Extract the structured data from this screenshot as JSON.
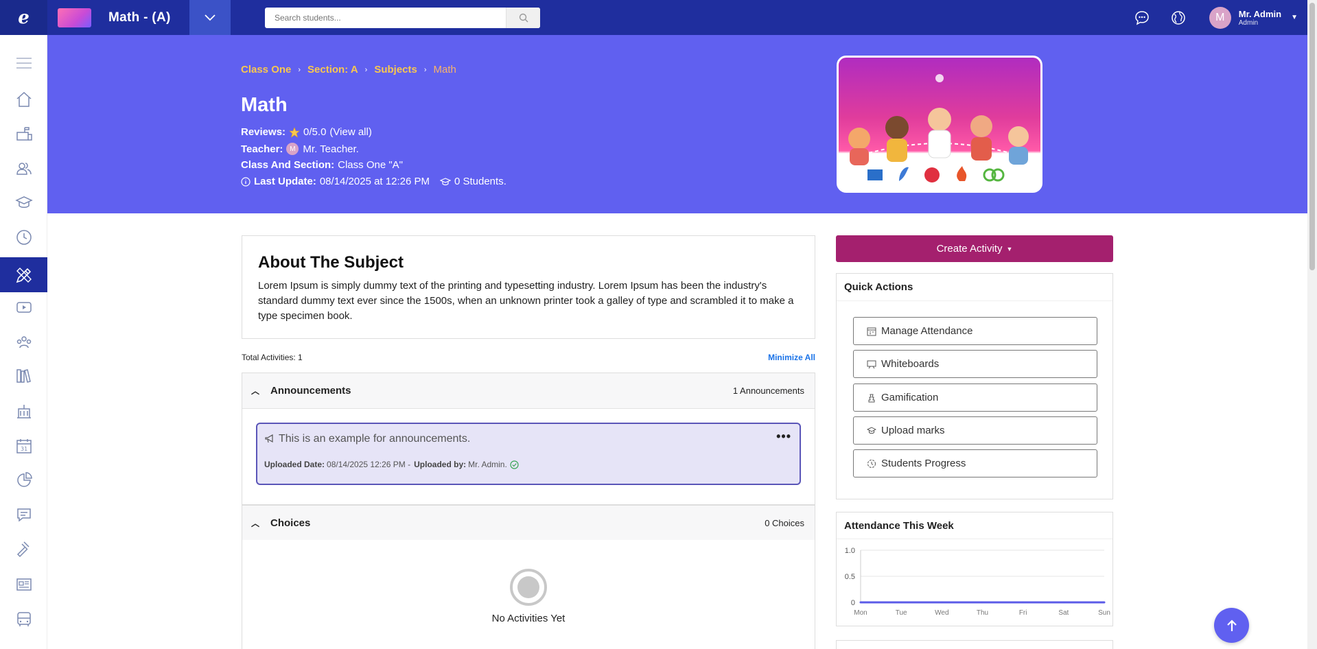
{
  "topbar": {
    "logo": "e",
    "app_title": "Math - (A)",
    "search_placeholder": "Search students...",
    "user": {
      "initial": "M",
      "name": "Mr. Admin",
      "role": "Admin"
    }
  },
  "sidebar": {
    "items": [
      {
        "icon": "menu-icon"
      },
      {
        "icon": "home-icon"
      },
      {
        "icon": "mailbox-icon"
      },
      {
        "icon": "users-icon"
      },
      {
        "icon": "graduation-cap-icon"
      },
      {
        "icon": "clock-icon"
      },
      {
        "icon": "subjects-pencil-ruler-icon",
        "active": true
      },
      {
        "icon": "video-icon"
      },
      {
        "icon": "group-icon"
      },
      {
        "icon": "library-icon"
      },
      {
        "icon": "building-icon"
      },
      {
        "icon": "calendar-icon"
      },
      {
        "icon": "pie-chart-icon"
      },
      {
        "icon": "chat-icon"
      },
      {
        "icon": "gavel-icon"
      },
      {
        "icon": "newspaper-icon"
      },
      {
        "icon": "bus-icon"
      }
    ]
  },
  "hero": {
    "breadcrumb": [
      "Class One",
      "Section: A",
      "Subjects",
      "Math"
    ],
    "title": "Math",
    "reviews_label": "Reviews:",
    "reviews_value": "0/5.0",
    "reviews_link": "(View all)",
    "teacher_label": "Teacher:",
    "teacher_initial": "M",
    "teacher_name": "Mr. Teacher.",
    "class_label": "Class And Section:",
    "class_value": "Class One \"A\"",
    "update_label": "Last Update:",
    "update_value": "08/14/2025 at 12:26 PM",
    "students": "0 Students."
  },
  "about": {
    "title": "About The Subject",
    "text": "Lorem Ipsum is simply dummy text of the printing and typesetting industry. Lorem Ipsum has been the industry's standard dummy text ever since the 1500s, when an unknown printer took a galley of type and scrambled it to make a type specimen book."
  },
  "activities": {
    "total": "Total Activities: 1",
    "minimize": "Minimize All",
    "announcements": {
      "title": "Announcements",
      "count": "1 Announcements",
      "item": {
        "message": "This is an example for announcements.",
        "date_label": "Uploaded Date:",
        "date_value": "08/14/2025 12:26 PM -",
        "by_label": "Uploaded by:",
        "by_value": "Mr. Admin."
      }
    },
    "choices": {
      "title": "Choices",
      "count": "0 Choices"
    },
    "empty_text": "No Activities Yet"
  },
  "right": {
    "create_label": "Create Activity",
    "quick_actions_title": "Quick Actions",
    "quick_actions": [
      {
        "label": "Manage Attendance",
        "icon": "calendar-icon"
      },
      {
        "label": "Whiteboards",
        "icon": "whiteboard-icon"
      },
      {
        "label": "Gamification",
        "icon": "chess-icon"
      },
      {
        "label": "Upload marks",
        "icon": "graduation-cap-icon"
      },
      {
        "label": "Students Progress",
        "icon": "progress-icon"
      }
    ],
    "attendance_title": "Attendance This Week"
  },
  "chart_data": {
    "type": "line",
    "title": "Attendance This Week",
    "categories": [
      "Mon",
      "Tue",
      "Wed",
      "Thu",
      "Fri",
      "Sat",
      "Sun"
    ],
    "series": [
      {
        "values": [
          0,
          0,
          0,
          0,
          0,
          0,
          0
        ],
        "color": "#5b5be8"
      }
    ],
    "yticks": [
      "1.0",
      "0.5",
      "0"
    ],
    "ylim": [
      0,
      1
    ],
    "grid": true
  },
  "colors": {
    "topbar": "#1f2e9e",
    "hero": "#6060f0",
    "breadcrumb": "#f9c74f",
    "create_button": "#a4206e",
    "announcement_bg": "#e6e4f7",
    "announcement_border": "#5a55b8"
  }
}
